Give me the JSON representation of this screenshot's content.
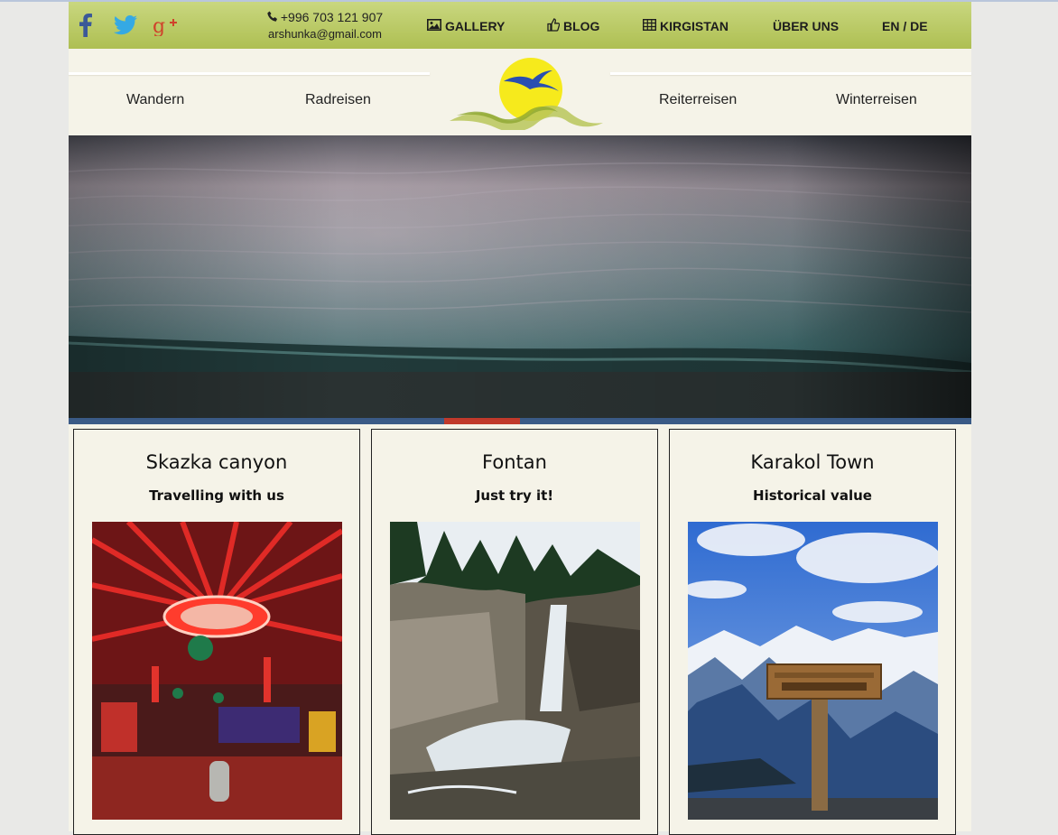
{
  "topbar": {
    "social": [
      "facebook-icon",
      "twitter-icon",
      "google-plus-icon"
    ],
    "phone": "+996 703 121 907",
    "email": "arshunka@gmail.com",
    "nav": [
      {
        "label": "GALLERY",
        "icon": "image-icon"
      },
      {
        "label": "BLOG",
        "icon": "thumbs-up-icon"
      },
      {
        "label": "KIRGISTAN",
        "icon": "table-icon"
      },
      {
        "label": "ÜBER UNS"
      },
      {
        "label": "EN / DE"
      }
    ]
  },
  "menu": {
    "items": [
      "Wandern",
      "Radreisen",
      "Reiterreisen",
      "Winterreisen"
    ]
  },
  "slider": {
    "active_slide": 6
  },
  "cards": [
    {
      "title": "Skazka canyon",
      "subtitle": "Travelling with us",
      "image": "yurt-interior-photo"
    },
    {
      "title": "Fontan",
      "subtitle": "Just try it!",
      "image": "waterfall-photo"
    },
    {
      "title": "Karakol Town",
      "subtitle": "Historical value",
      "image": "karakol-sign-photo"
    }
  ],
  "colors": {
    "topbar": "#b8c75f",
    "page_bg": "#f5f3e8",
    "slider_active": "#c0392b",
    "slider_bar": "#3a5a86",
    "facebook": "#3b5998",
    "twitter": "#35a9e4",
    "google_plus": "#d0422b"
  }
}
